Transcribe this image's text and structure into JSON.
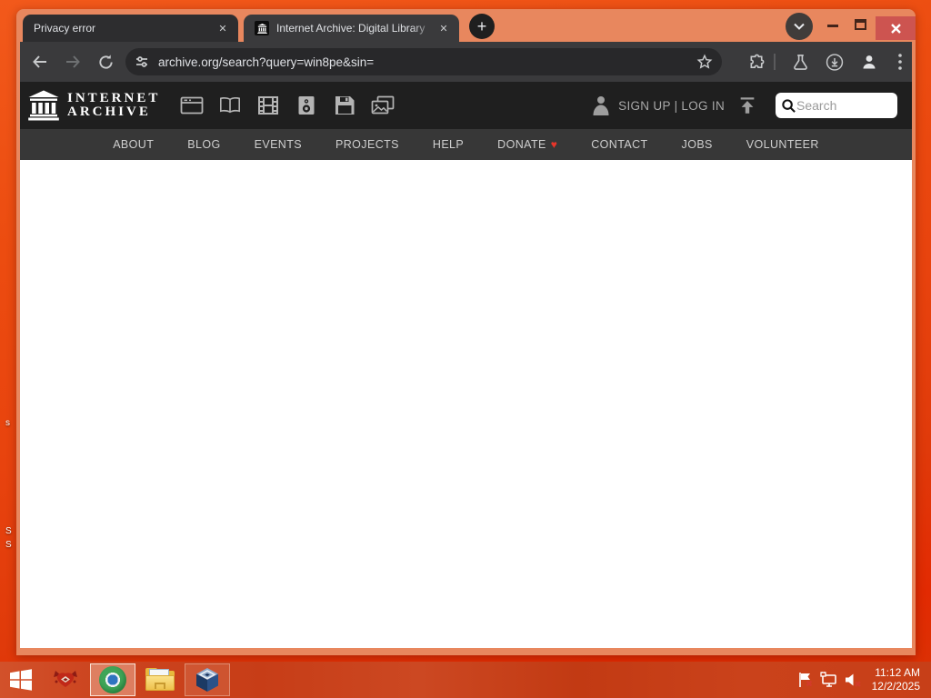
{
  "browser": {
    "tabs": [
      {
        "title": "Privacy error"
      },
      {
        "title": "Internet Archive: Digital Library"
      }
    ],
    "url": "archive.org/search?query=win8pe&sin="
  },
  "ia": {
    "logo_line1": "INTERNET",
    "logo_line2": "ARCHIVE",
    "media_types": [
      "web",
      "texts",
      "video",
      "audio",
      "software",
      "images"
    ],
    "signup_login": "SIGN UP | LOG IN",
    "search_placeholder": "Search",
    "nav_items": [
      "ABOUT",
      "BLOG",
      "EVENTS",
      "PROJECTS",
      "HELP",
      "DONATE",
      "CONTACT",
      "JOBS",
      "VOLUNTEER"
    ]
  },
  "glyphs": {
    "tab_close": "✕",
    "new_tab_plus": "+",
    "donate_heart": "♥"
  },
  "taskbar": {
    "time": "11:12 AM",
    "date": "12/2/2025"
  },
  "desktop": {
    "fragments": [
      "s",
      "S",
      "S"
    ]
  },
  "colors": {
    "frame_salmon": "#e8875e",
    "desktop_orange": "#e8430e",
    "taskbar_red": "#c73d17",
    "close_button_red": "#cd5450",
    "toolbar_gray": "#3a3a3c",
    "ia_header_black": "#1f1f1f",
    "ia_nav_gray": "#373737",
    "heart_red": "#e8352a"
  }
}
